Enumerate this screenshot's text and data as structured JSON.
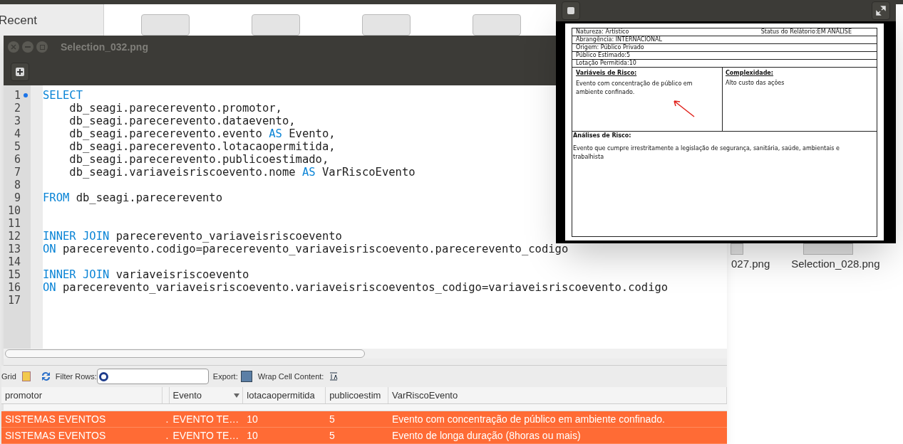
{
  "file_manager": {
    "sidebar_items": [
      "Recent"
    ],
    "files": [
      "027.png",
      "Selection_028.png"
    ]
  },
  "editor_window": {
    "title": "Selection_032.png",
    "lines": [
      {
        "number": "1",
        "marked": true,
        "segments": [
          {
            "kind": "keyword",
            "text": "SELECT"
          }
        ]
      },
      {
        "number": "2",
        "marked": false,
        "segments": [
          {
            "kind": "plain",
            "text": "    db_seagi.parecerevento.promotor,"
          }
        ]
      },
      {
        "number": "3",
        "marked": false,
        "segments": [
          {
            "kind": "plain",
            "text": "    db_seagi.parecerevento.dataevento,"
          }
        ]
      },
      {
        "number": "4",
        "marked": false,
        "segments": [
          {
            "kind": "plain",
            "text": "    db_seagi.parecerevento.evento "
          },
          {
            "kind": "keyword",
            "text": "AS"
          },
          {
            "kind": "plain",
            "text": " Evento,"
          }
        ]
      },
      {
        "number": "5",
        "marked": false,
        "segments": [
          {
            "kind": "plain",
            "text": "    db_seagi.parecerevento.lotacaopermitida,"
          }
        ]
      },
      {
        "number": "6",
        "marked": false,
        "segments": [
          {
            "kind": "plain",
            "text": "    db_seagi.parecerevento.publicoestimado,"
          }
        ]
      },
      {
        "number": "7",
        "marked": false,
        "segments": [
          {
            "kind": "plain",
            "text": "    db_seagi.variaveisriscoevento.nome "
          },
          {
            "kind": "keyword",
            "text": "AS"
          },
          {
            "kind": "plain",
            "text": " VarRiscoEvento"
          }
        ]
      },
      {
        "number": "8",
        "marked": false
      },
      {
        "number": "9",
        "marked": false,
        "segments": [
          {
            "kind": "keyword",
            "text": "FROM"
          },
          {
            "kind": "plain",
            "text": " db_seagi.parecerevento"
          }
        ]
      },
      {
        "number": "10",
        "marked": false
      },
      {
        "number": "11",
        "marked": false
      },
      {
        "number": "12",
        "marked": false,
        "segments": [
          {
            "kind": "keyword",
            "text": "INNER JOIN"
          },
          {
            "kind": "plain",
            "text": " parecerevento_variaveisriscoevento"
          }
        ]
      },
      {
        "number": "13",
        "marked": false,
        "segments": [
          {
            "kind": "keyword",
            "text": "ON"
          },
          {
            "kind": "plain",
            "text": " parecerevento.codigo=parecerevento_variaveisriscoevento.parecerevento_codigo"
          }
        ]
      },
      {
        "number": "14",
        "marked": false
      },
      {
        "number": "15",
        "marked": false,
        "segments": [
          {
            "kind": "keyword",
            "text": "INNER JOIN"
          },
          {
            "kind": "plain",
            "text": " variaveisriscoevento"
          }
        ]
      },
      {
        "number": "16",
        "marked": false,
        "segments": [
          {
            "kind": "keyword",
            "text": "ON"
          },
          {
            "kind": "plain",
            "text": " parecerevento_variaveisriscoevento.variaveisriscoeventos_codigo=variaveisriscoevento.codigo"
          }
        ]
      },
      {
        "number": "17",
        "marked": false
      }
    ],
    "toolbar": {
      "grid": "Grid",
      "filter": "Filter Rows:",
      "export": "Export:",
      "wrap": "Wrap Cell Content:"
    },
    "columns": [
      "promotor",
      "",
      "Evento",
      "lotacaopermitida",
      "publicoestim",
      "VarRiscoEvento"
    ],
    "rows": [
      {
        "selected": true,
        "cells": [
          "SISTEMAS EVENTOS",
          ".",
          "EVENTO TE…",
          "10",
          "5",
          "Evento com concentração de público em ambiente confinado."
        ]
      },
      {
        "selected": true,
        "cells": [
          "SISTEMAS EVENTOS",
          ".",
          "EVENTO TE…",
          "10",
          "5",
          "Evento de longa duração (8horas ou mais)"
        ]
      }
    ]
  },
  "viewer_window": {
    "report": {
      "natureza": "Natureza: Artístico",
      "status": "Status do Relátorio:EM ANÁLISE",
      "lines": [
        "Abrangência: INTERNACIONAL",
        "Origem: Público Privado",
        "Público Estimado:5",
        "Lotação Permitida:10"
      ],
      "variaveis_heading": "Variáveis de Risco:",
      "variaveis_text": "Evento com concentração de público em ambiente confinado.",
      "complexidade_heading": "Complexidade:",
      "complexidade_text": "Alto custo das ações",
      "analises_heading": "Análises de Risco:",
      "analises_text": "Evento que cumpre irrestritamente a legislação de segurança, sanitária, saúde, ambientais e trabalhista"
    }
  }
}
